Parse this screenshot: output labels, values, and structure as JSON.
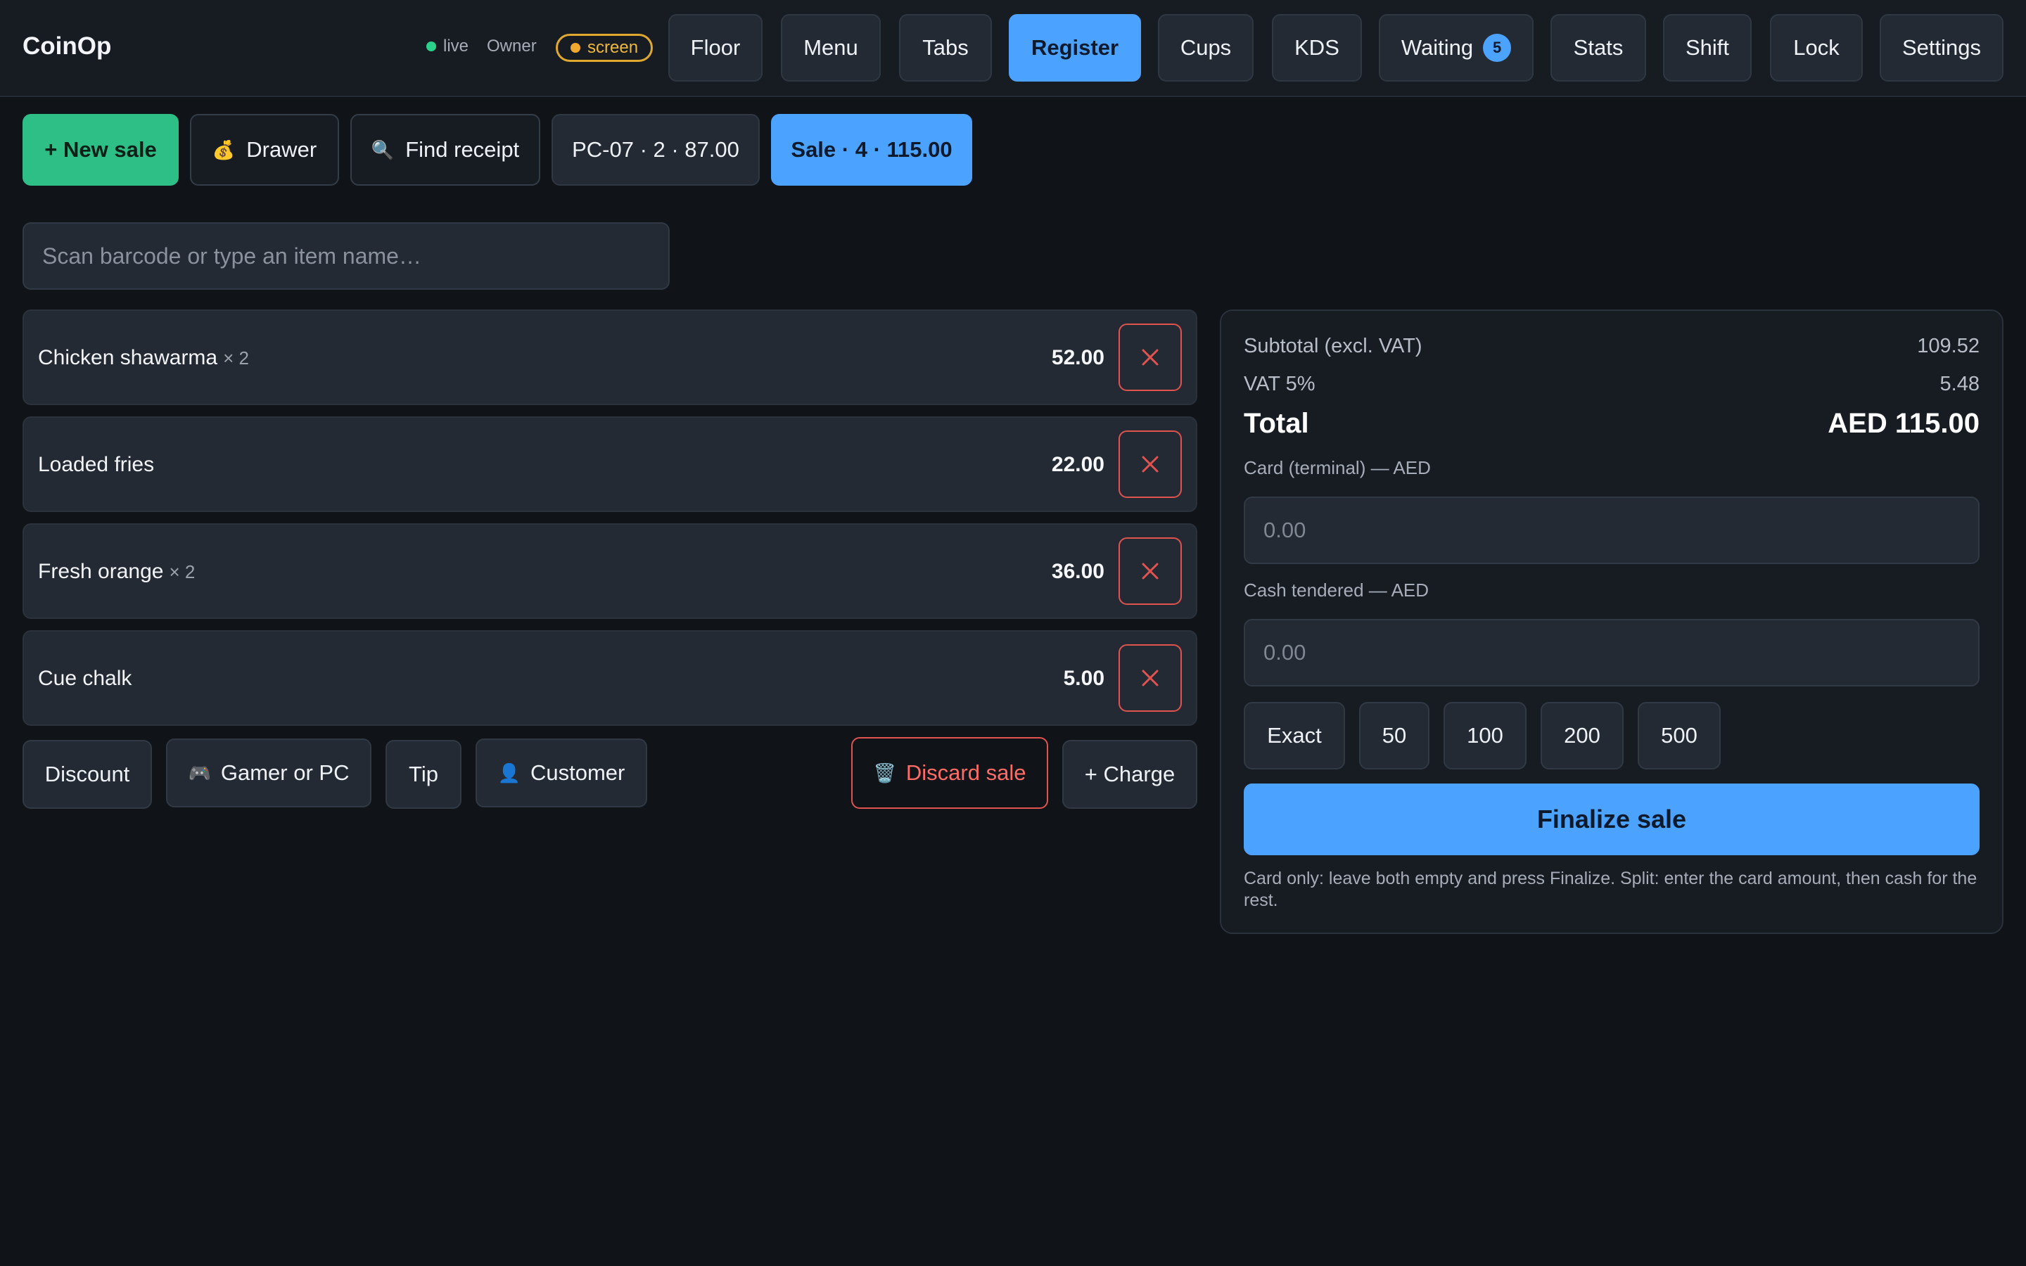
{
  "app": {
    "name": "CoinOp"
  },
  "status": {
    "live_label": "live",
    "role": "Owner",
    "mode_label": "screen"
  },
  "nav": {
    "items": [
      {
        "label": "Floor"
      },
      {
        "label": "Menu"
      },
      {
        "label": "Tabs"
      },
      {
        "label": "Register",
        "active": true
      },
      {
        "label": "Cups"
      },
      {
        "label": "KDS"
      },
      {
        "label": "Waiting",
        "badge": "5"
      },
      {
        "label": "Stats"
      },
      {
        "label": "Shift"
      },
      {
        "label": "Lock"
      },
      {
        "label": "Settings"
      }
    ]
  },
  "actions": {
    "new_sale": "+ New sale",
    "drawer": "Drawer",
    "find_receipt": "Find receipt",
    "open_tabs": [
      {
        "label": "PC-07 · 2 · 87.00"
      },
      {
        "label": "Sale · 4 · 115.00",
        "active": true
      }
    ]
  },
  "search": {
    "placeholder": "Scan barcode or type an item name…"
  },
  "cart": {
    "items": [
      {
        "name": "Chicken shawarma",
        "qty": "× 2",
        "price": "52.00"
      },
      {
        "name": "Loaded fries",
        "qty": "",
        "price": "22.00"
      },
      {
        "name": "Fresh orange",
        "qty": "× 2",
        "price": "36.00"
      },
      {
        "name": "Cue chalk",
        "qty": "",
        "price": "5.00"
      }
    ],
    "buttons": {
      "discount": "Discount",
      "gamer_pc": "Gamer or PC",
      "tip": "Tip",
      "customer": "Customer",
      "discard": "Discard sale",
      "charge": "+ Charge"
    }
  },
  "payment": {
    "subtotal_label": "Subtotal (excl. VAT)",
    "subtotal_value": "109.52",
    "vat_label": "VAT 5%",
    "vat_value": "5.48",
    "total_label": "Total",
    "total_value": "AED 115.00",
    "card_label": "Card (terminal) — AED",
    "card_placeholder": "0.00",
    "cash_label": "Cash tendered — AED",
    "cash_placeholder": "0.00",
    "quick_amounts": [
      "Exact",
      "50",
      "100",
      "200",
      "500"
    ],
    "finalize": "Finalize sale",
    "hint": "Card only: leave both empty and press Finalize. Split: enter the card amount, then cash for the rest."
  },
  "colors": {
    "accent": "#4ca3ff",
    "success": "#2dbf86",
    "danger": "#e0534f",
    "warning": "#f0a82e"
  }
}
